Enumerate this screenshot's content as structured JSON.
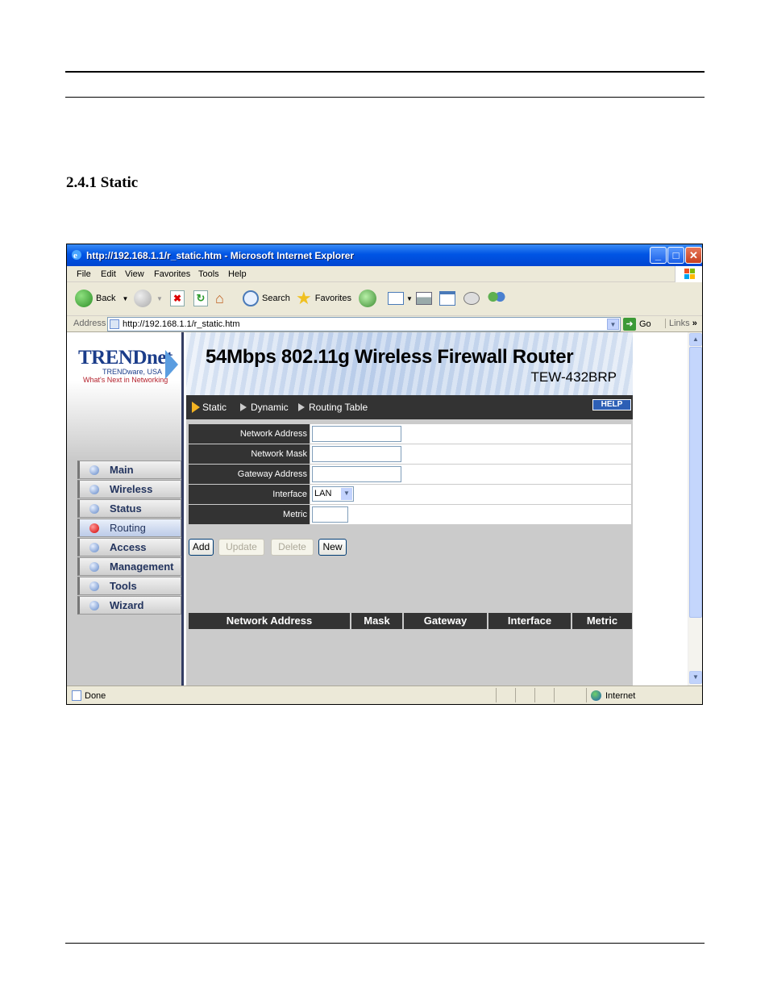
{
  "document": {
    "section_heading": "2.4.1  Static"
  },
  "browser": {
    "title": "http://192.168.1.1/r_static.htm - Microsoft Internet Explorer",
    "menu": [
      "File",
      "Edit",
      "View",
      "Favorites",
      "Tools",
      "Help"
    ],
    "toolbar": {
      "back_label": "Back",
      "search_label": "Search",
      "favorites_label": "Favorites"
    },
    "address": {
      "label": "Address",
      "url": "http://192.168.1.1/r_static.htm",
      "go_label": "Go",
      "links_label": "Links"
    },
    "status": {
      "text": "Done",
      "zone": "Internet"
    }
  },
  "router": {
    "logo": {
      "brand": "TRENDnet",
      "company": "TRENDware, USA",
      "tagline": "What's Next in Networking"
    },
    "banner": {
      "title": "54Mbps 802.11g Wireless Firewall Router",
      "model": "TEW-432BRP"
    },
    "nav": [
      "Main",
      "Wireless",
      "Status",
      "Routing",
      "Access",
      "Management",
      "Tools",
      "Wizard"
    ],
    "nav_active": "Routing",
    "subnav": [
      "Static",
      "Dynamic",
      "Routing Table"
    ],
    "help_label": "HELP",
    "form": {
      "network_address_label": "Network Address",
      "network_mask_label": "Network Mask",
      "gateway_address_label": "Gateway Address",
      "interface_label": "Interface",
      "interface_value": "LAN",
      "metric_label": "Metric"
    },
    "buttons": {
      "add": "Add",
      "update": "Update",
      "delete": "Delete",
      "new": "New"
    },
    "table_headers": [
      "Network Address",
      "Mask",
      "Gateway",
      "Interface",
      "Metric"
    ]
  }
}
